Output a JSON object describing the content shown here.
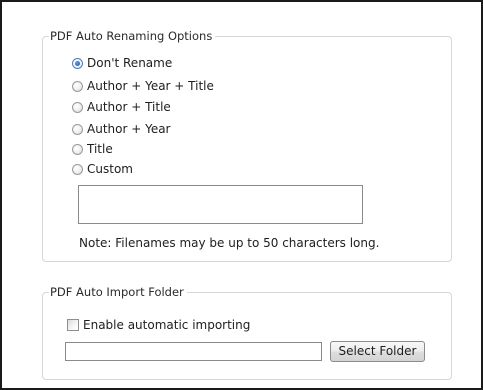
{
  "rename_group": {
    "legend": "PDF Auto Renaming Options",
    "options": [
      {
        "label": "Don't Rename",
        "selected": true
      },
      {
        "label": "Author + Year + Title",
        "selected": false
      },
      {
        "label": "Author + Title",
        "selected": false
      },
      {
        "label": "Author + Year",
        "selected": false
      },
      {
        "label": "Title",
        "selected": false
      },
      {
        "label": "Custom",
        "selected": false
      }
    ],
    "custom_value": "",
    "note": "Note: Filenames may be up to 50 characters long."
  },
  "import_group": {
    "legend": "PDF Auto Import Folder",
    "enable_label": "Enable automatic importing",
    "enable_checked": false,
    "folder_value": "",
    "select_folder_label": "Select Folder"
  }
}
